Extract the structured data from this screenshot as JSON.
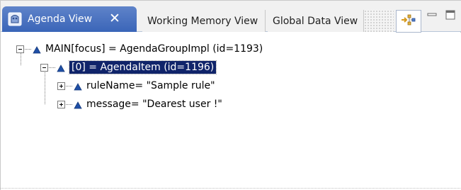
{
  "tabs": {
    "active": {
      "label": "Agenda View",
      "icon": "agenda-view-icon",
      "close_glyph": "✕"
    },
    "items": [
      {
        "label": "Working Memory View"
      },
      {
        "label": "Global Data View"
      }
    ]
  },
  "toolbar": {
    "tree_layout_icon": "tree-layout-icon",
    "minimize_icon": "minimize-icon",
    "maximize_icon": "maximize-icon"
  },
  "tree": {
    "root": {
      "label": "MAIN[focus] = AgendaGroupImpl  (id=1193)"
    },
    "item": {
      "label": "[0] = AgendaItem  (id=1196)"
    },
    "children": [
      {
        "label": "ruleName= \"Sample rule\""
      },
      {
        "label": "message= \"Dearest user !\""
      }
    ]
  },
  "colors": {
    "active_tab": "#3a65b8",
    "selection": "#10246a",
    "node_icon": "#1f4fa6"
  }
}
